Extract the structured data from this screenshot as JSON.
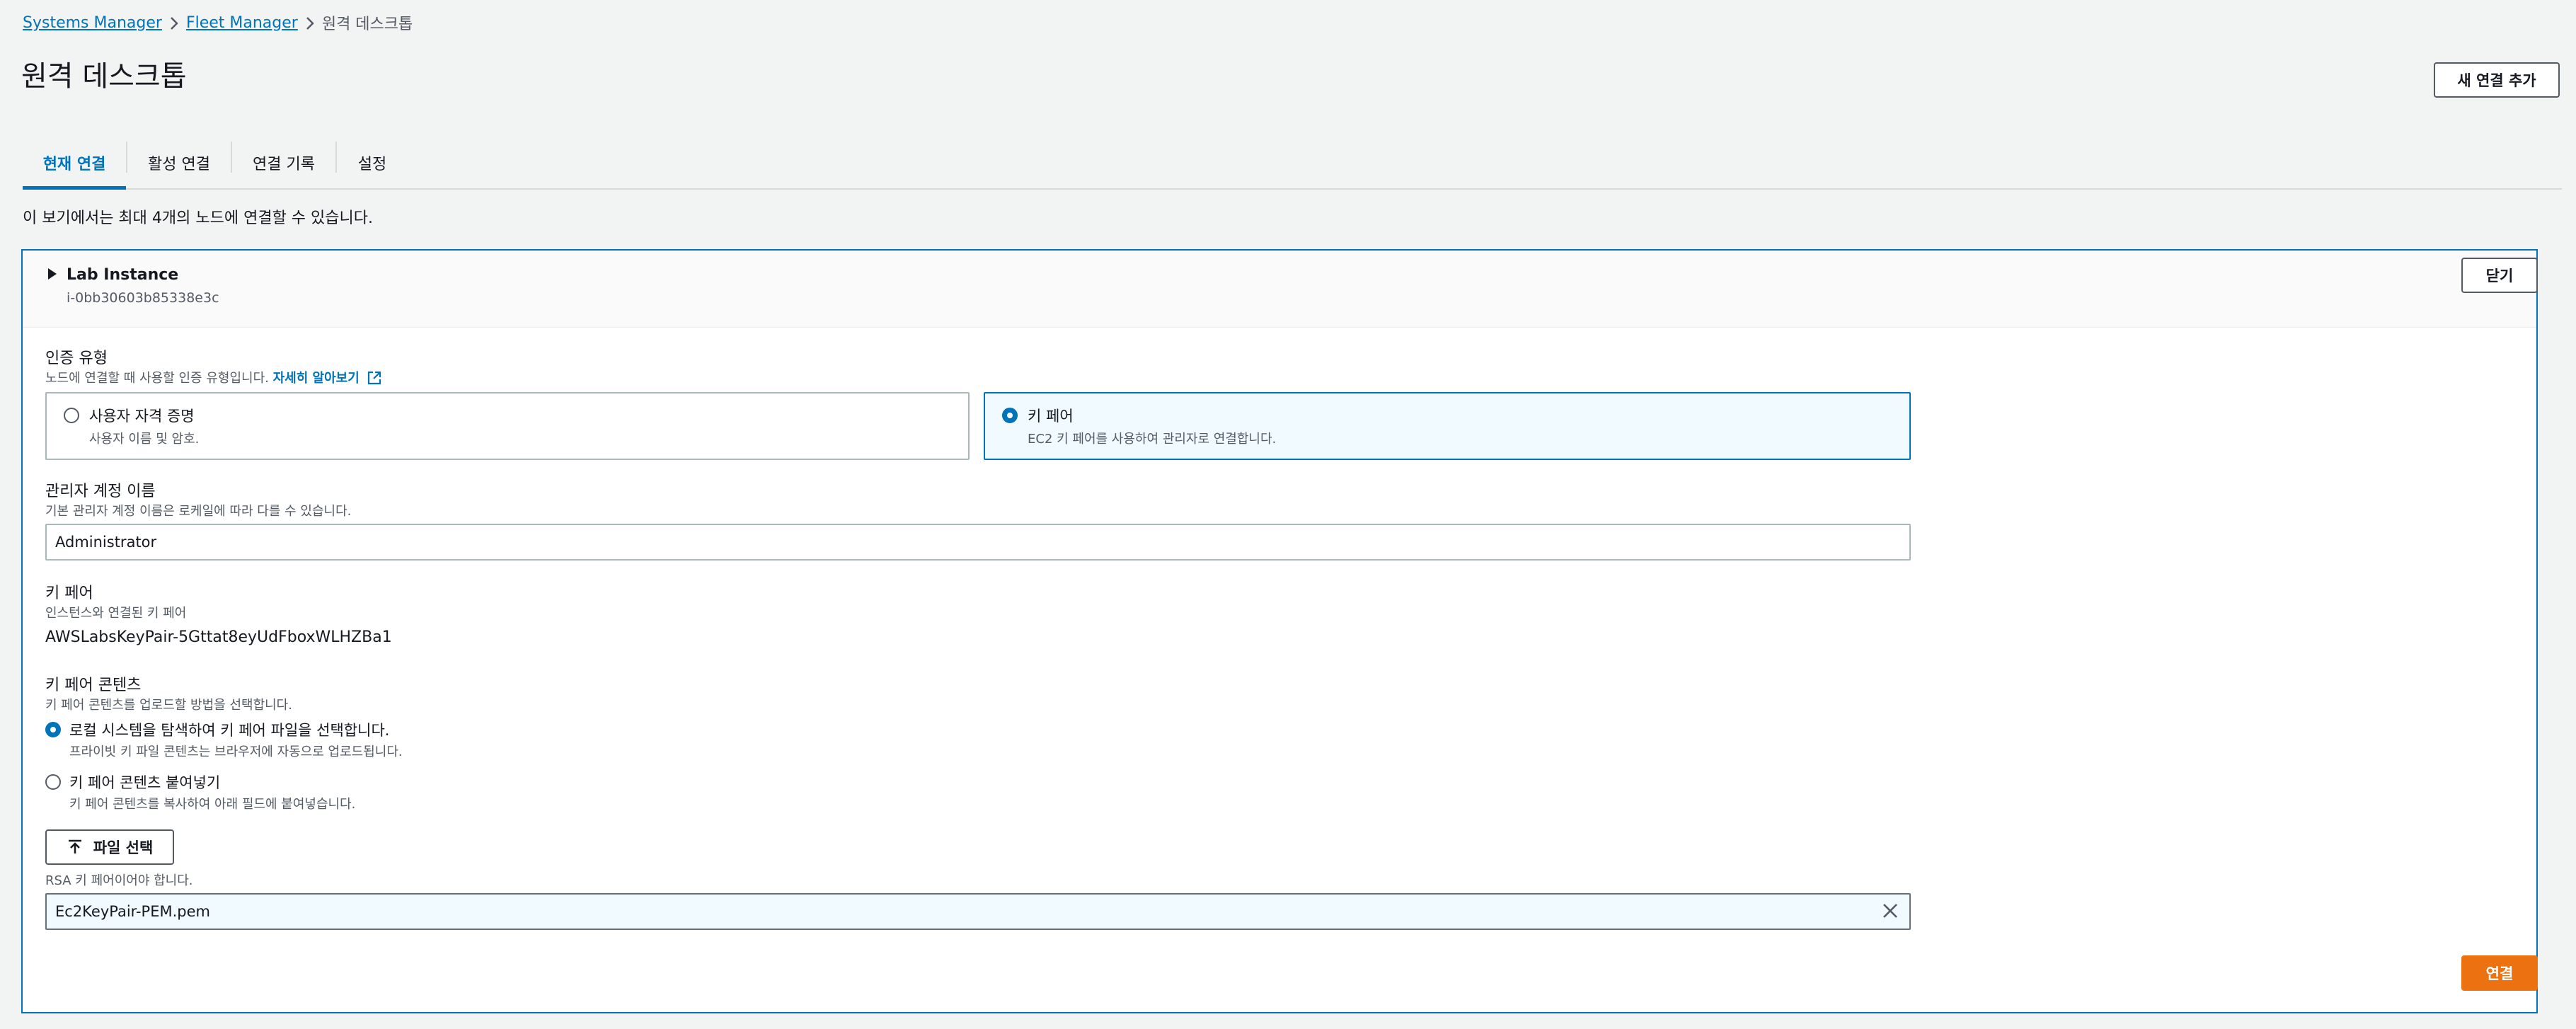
{
  "breadcrumb": {
    "items": [
      "Systems Manager",
      "Fleet Manager"
    ],
    "current": "원격 데스크톱"
  },
  "page": {
    "title": "원격 데스크톱",
    "new_connection_label": "새 연결 추가"
  },
  "tabs": [
    {
      "label": "현재 연결",
      "active": true
    },
    {
      "label": "활성 연결",
      "active": false
    },
    {
      "label": "연결 기록",
      "active": false
    },
    {
      "label": "설정",
      "active": false
    }
  ],
  "info_text": "이 보기에서는 최대 4개의 노드에 연결할 수 있습니다.",
  "instance": {
    "name": "Lab Instance",
    "id": "i-0bb30603b85338e3c",
    "close_label": "닫기"
  },
  "auth": {
    "label": "인증 유형",
    "description": "노드에 연결할 때 사용할 인증 유형입니다.",
    "learn_more": "자세히 알아보기",
    "options": [
      {
        "title": "사용자 자격 증명",
        "desc": "사용자 이름 및 암호.",
        "selected": false
      },
      {
        "title": "키 페어",
        "desc": "EC2 키 페어를 사용하여 관리자로 연결합니다.",
        "selected": true
      }
    ]
  },
  "admin": {
    "label": "관리자 계정 이름",
    "description": "기본 관리자 계정 이름은 로케일에 따라 다를 수 있습니다.",
    "value": "Administrator"
  },
  "keypair": {
    "label": "키 페어",
    "description": "인스턴스와 연결된 키 페어",
    "value": "AWSLabsKeyPair-5Gttat8eyUdFboxWLHZBa1"
  },
  "keypair_content": {
    "label": "키 페어 콘텐츠",
    "description": "키 페어 콘텐츠를 업로드할 방법을 선택합니다.",
    "options": [
      {
        "title": "로컬 시스템을 탐색하여 키 페어 파일을 선택합니다.",
        "desc": "프라이빗 키 파일 콘텐츠는 브라우저에 자동으로 업로드됩니다.",
        "selected": true
      },
      {
        "title": "키 페어 콘텐츠 붙여넣기",
        "desc": "키 페어 콘텐츠를 복사하여 아래 필드에 붙여넣습니다.",
        "selected": false
      }
    ],
    "file_button_label": "파일 선택",
    "constraint": "RSA 키 페어이어야 합니다.",
    "file_value": "Ec2KeyPair-PEM.pem"
  },
  "connect_label": "연결",
  "colors": {
    "link": "#0073bb",
    "primary": "#ec7211",
    "background": "#f2f3f3"
  }
}
